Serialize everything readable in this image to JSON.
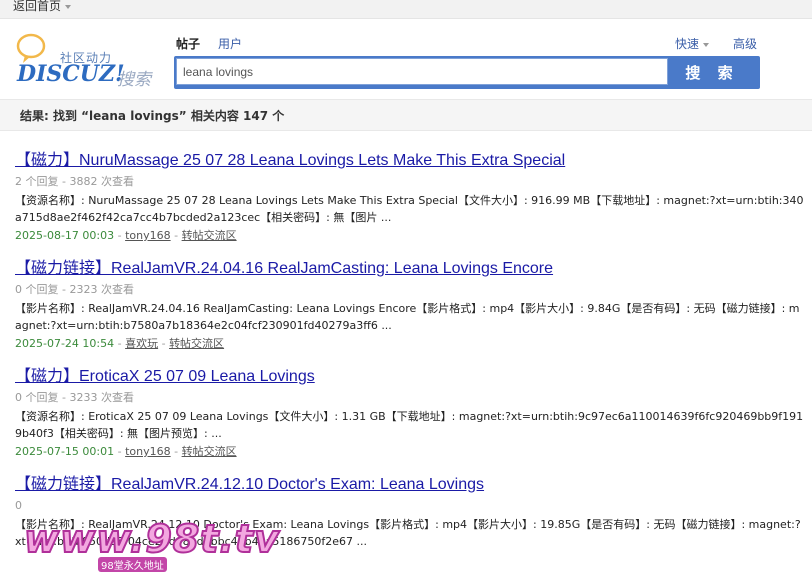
{
  "topbar": {
    "back_home": "返回首页"
  },
  "header": {
    "logo_zh": "社区动力",
    "logo_en": "DISCUZ!",
    "logo_search": "搜索",
    "tabs": [
      {
        "label": "帖子"
      },
      {
        "label": "用户"
      }
    ],
    "quick": "快速",
    "advanced": "高级",
    "search_value": "leana lovings",
    "search_button": "搜 索"
  },
  "result_summary": "结果: 找到 “leana lovings” 相关内容 147 个",
  "results": [
    {
      "title": "【磁力】NuruMassage 25 07 28 Leana Lovings Lets Make This Extra Special",
      "meta": "2 个回复 - 3882 次查看",
      "desc": "【资源名称】: NuruMassage 25 07 28 Leana Lovings Lets Make This Extra Special【文件大小】: 916.99 MB【下载地址】: magnet:?xt=urn:btih:340a715d8ae2f462f42ca7cc4b7bcded2a123cec【相关密码】: 無【图片 ...",
      "date": "2025-08-17 00:03",
      "author": "tony168",
      "forum": "转帖交流区"
    },
    {
      "title": "【磁力链接】RealJamVR.24.04.16 RealJamCasting: Leana Lovings Encore",
      "meta": "0 个回复 - 2323 次查看",
      "desc": "【影片名称】: RealJamVR.24.04.16 RealJamCasting: Leana Lovings Encore【影片格式】: mp4【影片大小】: 9.84G【是否有码】: 无码【磁力链接】: magnet:?xt=urn:btih:b7580a7b18364e2c04fcf230901fd40279a3ff6 ...",
      "date": "2025-07-24 10:54",
      "author": "喜欢玩",
      "forum": "转帖交流区"
    },
    {
      "title": "【磁力】EroticaX 25 07 09 Leana Lovings",
      "meta": "0 个回复 - 3233 次查看",
      "desc": "【资源名称】: EroticaX 25 07 09 Leana Lovings【文件大小】: 1.31 GB【下载地址】: magnet:?xt=urn:btih:9c97ec6a110014639f6fc920469bb9f1919b40f3【相关密码】: 無【图片预览】: ...",
      "date": "2025-07-15 00:01",
      "author": "tony168",
      "forum": "转帖交流区"
    },
    {
      "title": "【磁力链接】RealJamVR.24.12.10 Doctor's Exam: Leana Lovings",
      "meta": "0",
      "desc": "【影片名称】: RealJamVR.24.12.10 Doctor's Exam: Leana Lovings【影片格式】: mp4【影片大小】: 19.85G【是否有码】: 无码【磁力链接】: magnet:?xt=urn:btih:950d35f04ce26d081d0bbc43b4ba5186750f2e67 ...",
      "date": "",
      "author": "",
      "forum": ""
    }
  ],
  "watermark": {
    "text": "www.98t.tv",
    "sub": "98堂永久地址"
  }
}
